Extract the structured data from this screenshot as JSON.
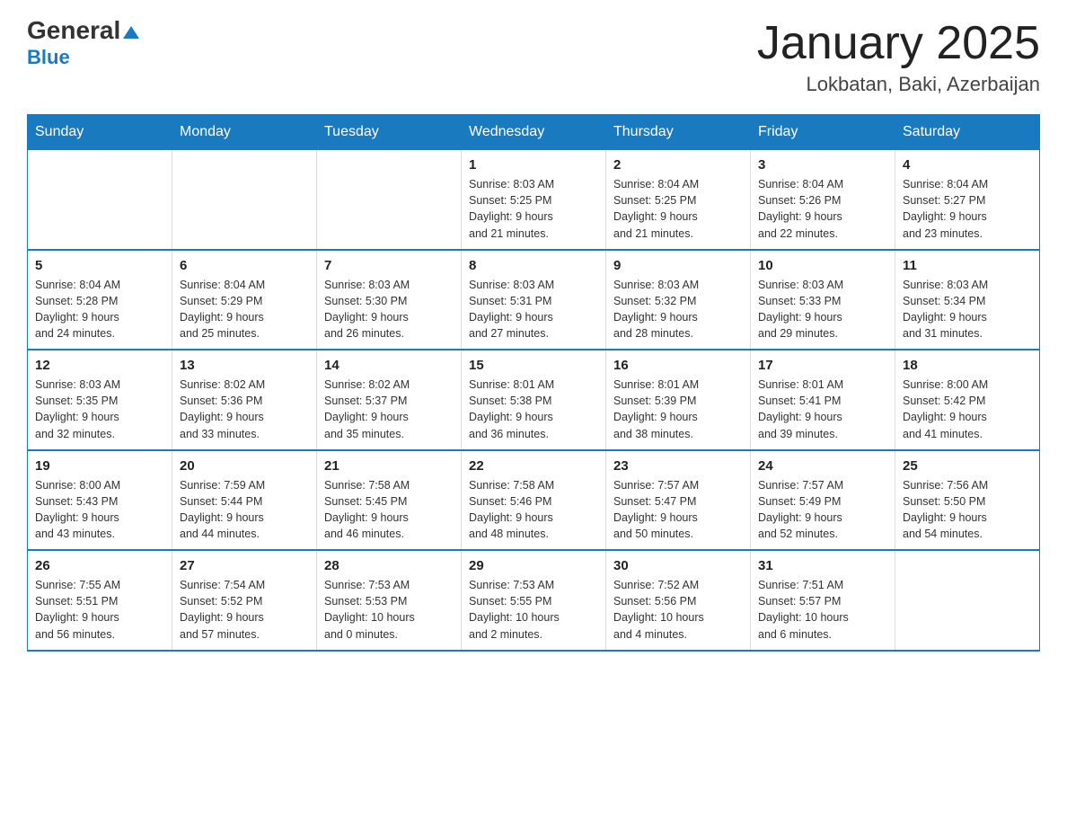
{
  "header": {
    "logo_general": "General",
    "logo_blue": "Blue",
    "main_title": "January 2025",
    "subtitle": "Lokbatan, Baki, Azerbaijan"
  },
  "calendar": {
    "weekdays": [
      "Sunday",
      "Monday",
      "Tuesday",
      "Wednesday",
      "Thursday",
      "Friday",
      "Saturday"
    ],
    "weeks": [
      {
        "days": [
          {
            "date": "",
            "info": ""
          },
          {
            "date": "",
            "info": ""
          },
          {
            "date": "",
            "info": ""
          },
          {
            "date": "1",
            "info": "Sunrise: 8:03 AM\nSunset: 5:25 PM\nDaylight: 9 hours\nand 21 minutes."
          },
          {
            "date": "2",
            "info": "Sunrise: 8:04 AM\nSunset: 5:25 PM\nDaylight: 9 hours\nand 21 minutes."
          },
          {
            "date": "3",
            "info": "Sunrise: 8:04 AM\nSunset: 5:26 PM\nDaylight: 9 hours\nand 22 minutes."
          },
          {
            "date": "4",
            "info": "Sunrise: 8:04 AM\nSunset: 5:27 PM\nDaylight: 9 hours\nand 23 minutes."
          }
        ]
      },
      {
        "days": [
          {
            "date": "5",
            "info": "Sunrise: 8:04 AM\nSunset: 5:28 PM\nDaylight: 9 hours\nand 24 minutes."
          },
          {
            "date": "6",
            "info": "Sunrise: 8:04 AM\nSunset: 5:29 PM\nDaylight: 9 hours\nand 25 minutes."
          },
          {
            "date": "7",
            "info": "Sunrise: 8:03 AM\nSunset: 5:30 PM\nDaylight: 9 hours\nand 26 minutes."
          },
          {
            "date": "8",
            "info": "Sunrise: 8:03 AM\nSunset: 5:31 PM\nDaylight: 9 hours\nand 27 minutes."
          },
          {
            "date": "9",
            "info": "Sunrise: 8:03 AM\nSunset: 5:32 PM\nDaylight: 9 hours\nand 28 minutes."
          },
          {
            "date": "10",
            "info": "Sunrise: 8:03 AM\nSunset: 5:33 PM\nDaylight: 9 hours\nand 29 minutes."
          },
          {
            "date": "11",
            "info": "Sunrise: 8:03 AM\nSunset: 5:34 PM\nDaylight: 9 hours\nand 31 minutes."
          }
        ]
      },
      {
        "days": [
          {
            "date": "12",
            "info": "Sunrise: 8:03 AM\nSunset: 5:35 PM\nDaylight: 9 hours\nand 32 minutes."
          },
          {
            "date": "13",
            "info": "Sunrise: 8:02 AM\nSunset: 5:36 PM\nDaylight: 9 hours\nand 33 minutes."
          },
          {
            "date": "14",
            "info": "Sunrise: 8:02 AM\nSunset: 5:37 PM\nDaylight: 9 hours\nand 35 minutes."
          },
          {
            "date": "15",
            "info": "Sunrise: 8:01 AM\nSunset: 5:38 PM\nDaylight: 9 hours\nand 36 minutes."
          },
          {
            "date": "16",
            "info": "Sunrise: 8:01 AM\nSunset: 5:39 PM\nDaylight: 9 hours\nand 38 minutes."
          },
          {
            "date": "17",
            "info": "Sunrise: 8:01 AM\nSunset: 5:41 PM\nDaylight: 9 hours\nand 39 minutes."
          },
          {
            "date": "18",
            "info": "Sunrise: 8:00 AM\nSunset: 5:42 PM\nDaylight: 9 hours\nand 41 minutes."
          }
        ]
      },
      {
        "days": [
          {
            "date": "19",
            "info": "Sunrise: 8:00 AM\nSunset: 5:43 PM\nDaylight: 9 hours\nand 43 minutes."
          },
          {
            "date": "20",
            "info": "Sunrise: 7:59 AM\nSunset: 5:44 PM\nDaylight: 9 hours\nand 44 minutes."
          },
          {
            "date": "21",
            "info": "Sunrise: 7:58 AM\nSunset: 5:45 PM\nDaylight: 9 hours\nand 46 minutes."
          },
          {
            "date": "22",
            "info": "Sunrise: 7:58 AM\nSunset: 5:46 PM\nDaylight: 9 hours\nand 48 minutes."
          },
          {
            "date": "23",
            "info": "Sunrise: 7:57 AM\nSunset: 5:47 PM\nDaylight: 9 hours\nand 50 minutes."
          },
          {
            "date": "24",
            "info": "Sunrise: 7:57 AM\nSunset: 5:49 PM\nDaylight: 9 hours\nand 52 minutes."
          },
          {
            "date": "25",
            "info": "Sunrise: 7:56 AM\nSunset: 5:50 PM\nDaylight: 9 hours\nand 54 minutes."
          }
        ]
      },
      {
        "days": [
          {
            "date": "26",
            "info": "Sunrise: 7:55 AM\nSunset: 5:51 PM\nDaylight: 9 hours\nand 56 minutes."
          },
          {
            "date": "27",
            "info": "Sunrise: 7:54 AM\nSunset: 5:52 PM\nDaylight: 9 hours\nand 57 minutes."
          },
          {
            "date": "28",
            "info": "Sunrise: 7:53 AM\nSunset: 5:53 PM\nDaylight: 10 hours\nand 0 minutes."
          },
          {
            "date": "29",
            "info": "Sunrise: 7:53 AM\nSunset: 5:55 PM\nDaylight: 10 hours\nand 2 minutes."
          },
          {
            "date": "30",
            "info": "Sunrise: 7:52 AM\nSunset: 5:56 PM\nDaylight: 10 hours\nand 4 minutes."
          },
          {
            "date": "31",
            "info": "Sunrise: 7:51 AM\nSunset: 5:57 PM\nDaylight: 10 hours\nand 6 minutes."
          },
          {
            "date": "",
            "info": ""
          }
        ]
      }
    ]
  }
}
